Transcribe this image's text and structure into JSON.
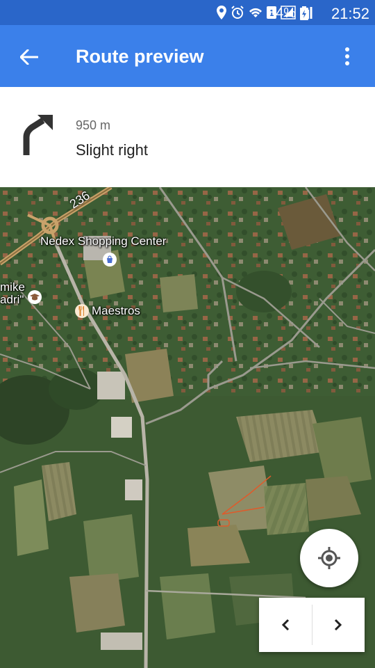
{
  "status_bar": {
    "battery_percent": "84%",
    "clock": "21:52",
    "sim_slot": "1"
  },
  "app_bar": {
    "title": "Route preview"
  },
  "step": {
    "distance": "950 m",
    "instruction": "Slight right",
    "maneuver_icon": "turn-slight-right-icon"
  },
  "map": {
    "road_number": "236",
    "labels": {
      "shopping_center": "Nedex Shopping Center",
      "restaurant": "Maestros",
      "partial_left_line1": "mike",
      "partial_left_line2": "adri\""
    }
  },
  "colors": {
    "status_bar": "#2a66c9",
    "app_bar": "#3b80ea",
    "route_line": "#e05a2a"
  }
}
